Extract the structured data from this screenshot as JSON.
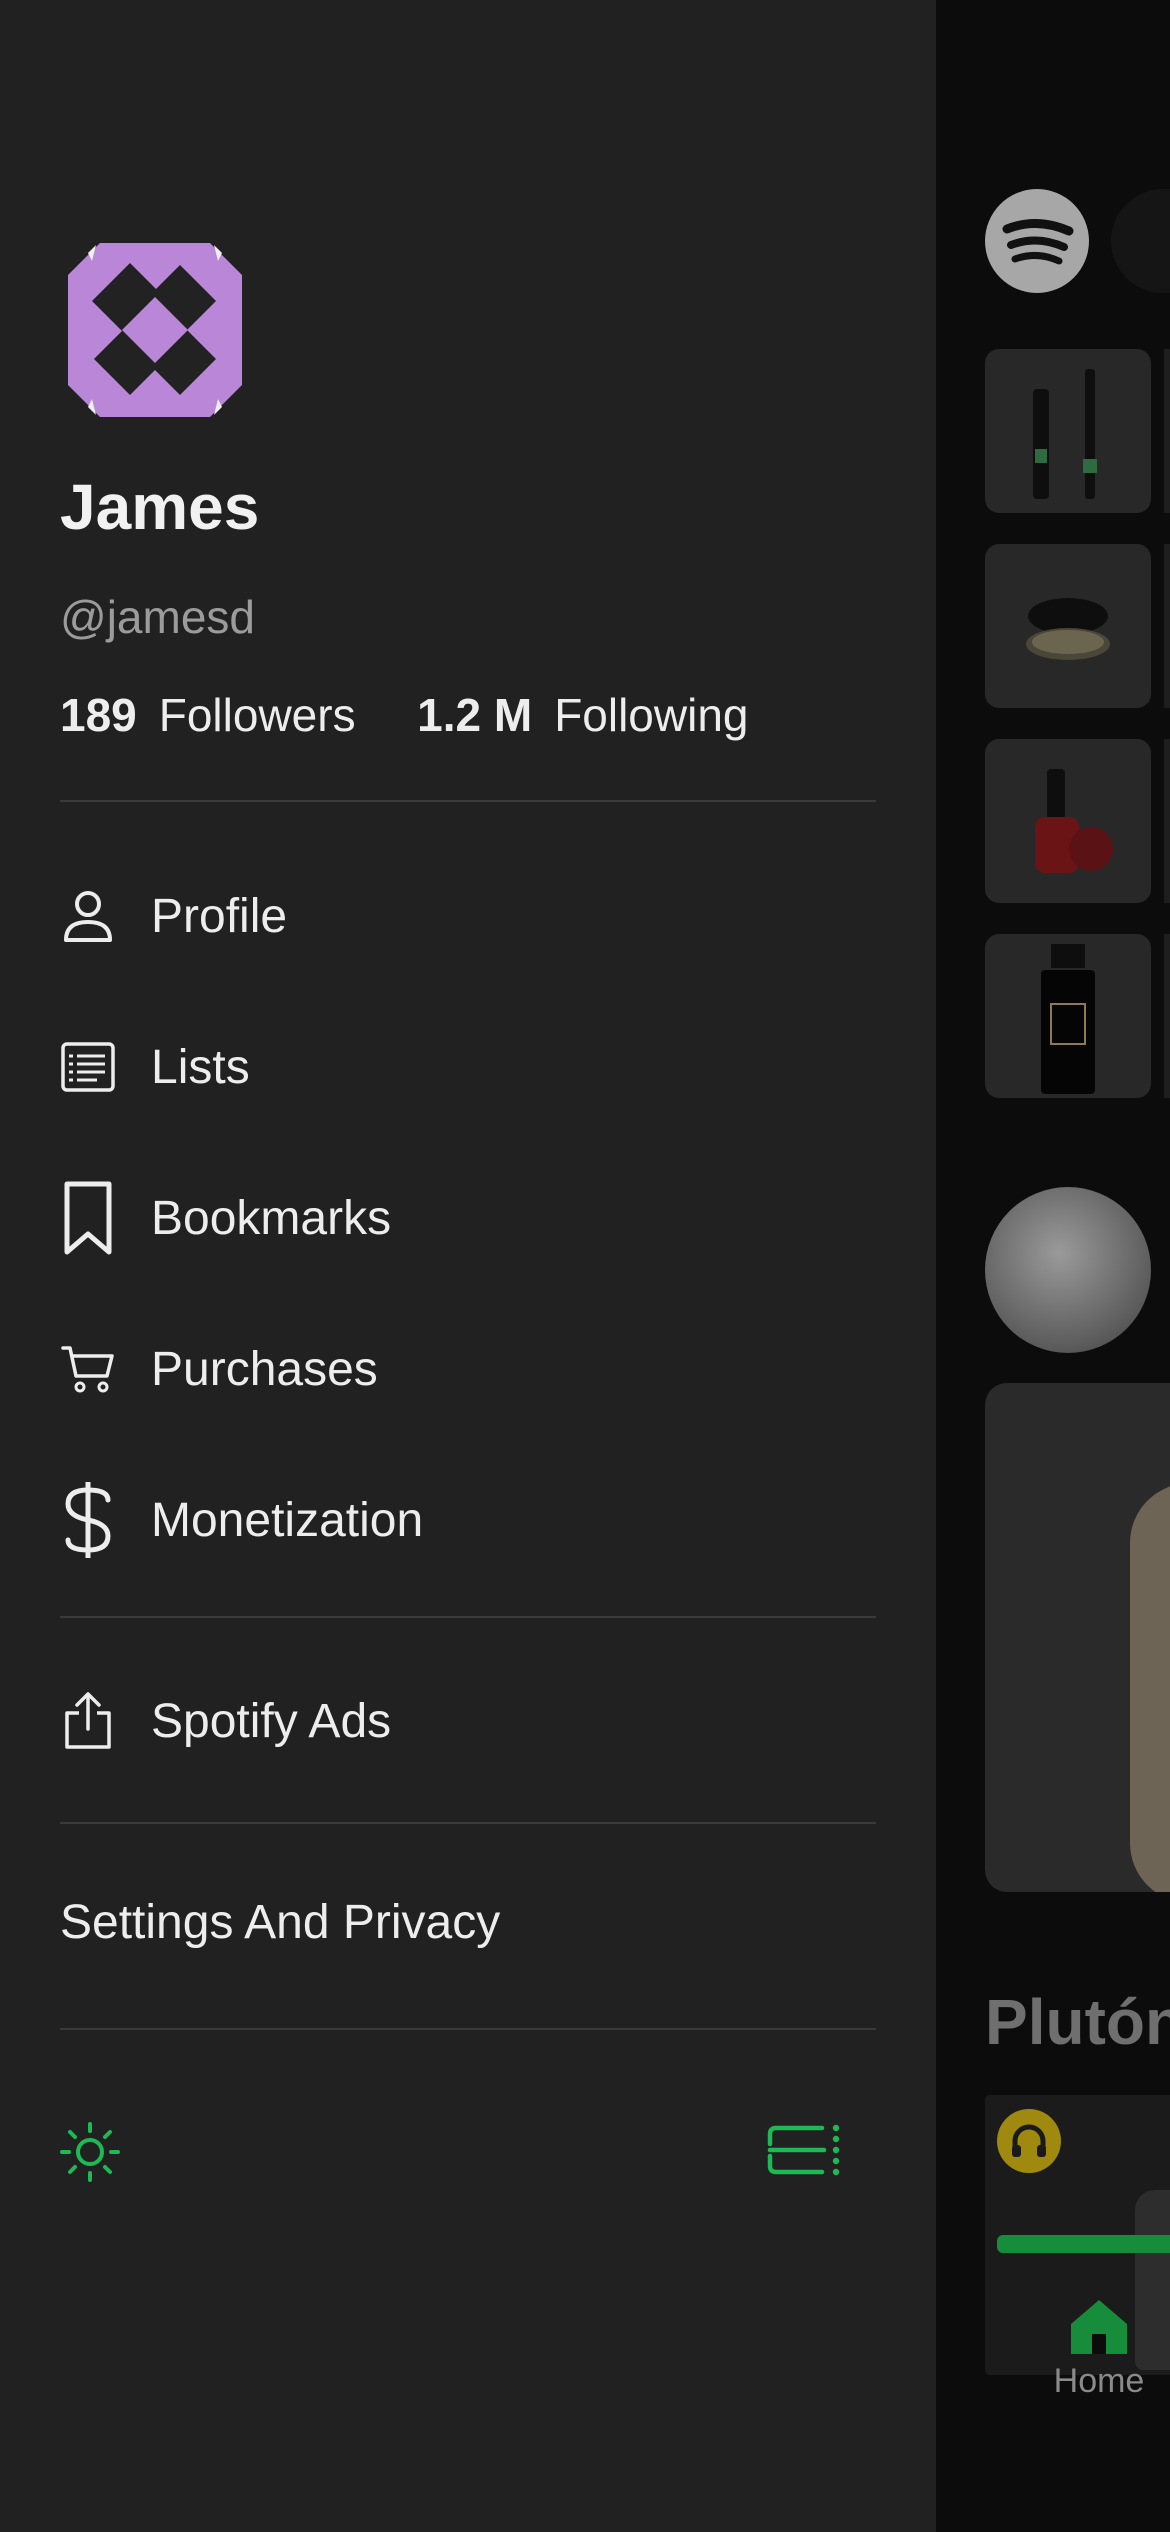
{
  "colors": {
    "drawer_bg": "#212121",
    "accent_green": "#1db954",
    "text_primary": "#ededed",
    "text_secondary": "#9b9b9b",
    "avatar_purple": "#b986d8"
  },
  "profile": {
    "name": "James",
    "handle": "@jamesd",
    "followers_count": "189",
    "followers_label": "Followers",
    "following_count": "1.2 M",
    "following_label": "Following"
  },
  "menu": {
    "items": [
      {
        "label": "Profile",
        "icon": "person-icon"
      },
      {
        "label": "Lists",
        "icon": "list-icon"
      },
      {
        "label": "Bookmarks",
        "icon": "bookmark-icon"
      },
      {
        "label": "Purchases",
        "icon": "cart-icon"
      },
      {
        "label": "Monetization",
        "icon": "dollar-icon"
      }
    ],
    "secondary": [
      {
        "label": "Spotify Ads",
        "icon": "share-icon"
      }
    ],
    "settings_label": "Settings And Privacy"
  },
  "footer": {
    "left_icon": "sun-icon",
    "right_icon": "qr-scan-icon"
  },
  "background": {
    "section_title_partial": "Plutón",
    "tab_home_label": "Home"
  }
}
